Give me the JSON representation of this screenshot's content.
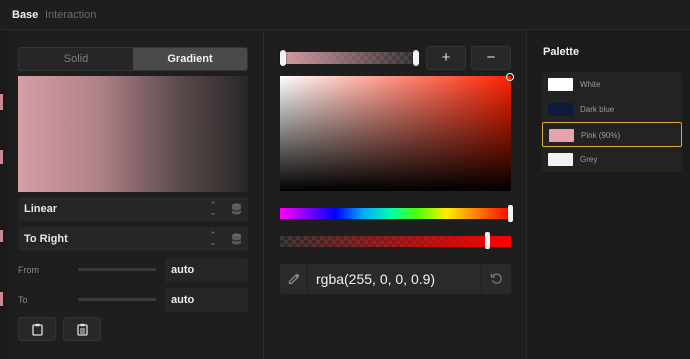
{
  "tabs": {
    "base": "Base",
    "interaction": "Interaction"
  },
  "fill_mode": {
    "solid": "Solid",
    "gradient": "Gradient",
    "selected": "Gradient"
  },
  "gradient": {
    "type": "Linear",
    "direction": "To Right",
    "from_label": "From",
    "from_value": "auto",
    "to_label": "To",
    "to_value": "auto"
  },
  "stops": {
    "add_label": "+",
    "remove_label": "−"
  },
  "color_value": "rgba(255, 0, 0, 0.9)",
  "palette": {
    "title": "Palette",
    "items": [
      {
        "name": "White",
        "color": "#ffffff",
        "selected": false
      },
      {
        "name": "Dark blue",
        "color": "#0c1a3c",
        "selected": false
      },
      {
        "name": "Pink (90%)",
        "color": "#e5a3ad",
        "selected": true
      },
      {
        "name": "Grey",
        "color": "#f2f2f2",
        "selected": false
      }
    ]
  },
  "colors": {
    "accent_selected": "#d9a63a",
    "pink": "#d69ea6"
  }
}
